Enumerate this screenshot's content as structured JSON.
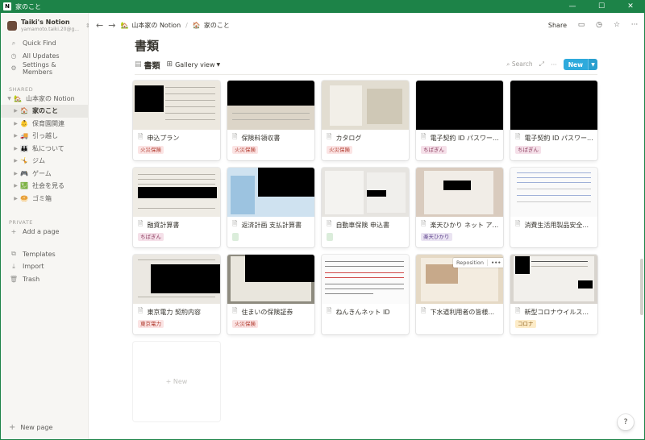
{
  "window": {
    "title": "家のこと",
    "app_icon": "N",
    "minimize": "—",
    "maximize": "☐",
    "close": "✕"
  },
  "workspace": {
    "name": "Taiki's Notion",
    "email": "yamamoto.taiki.20@g..."
  },
  "sidebar": {
    "nav": [
      {
        "label": "Quick Find",
        "icon": "search-icon"
      },
      {
        "label": "All Updates",
        "icon": "clock-icon"
      },
      {
        "label": "Settings & Members",
        "icon": "gear-icon"
      }
    ],
    "shared_label": "SHARED",
    "tree": [
      {
        "label": "山本家の Notion",
        "emoji": "🏡",
        "expanded": true,
        "level": 0
      },
      {
        "label": "家のこと",
        "emoji": "🏠",
        "active": true,
        "level": 1
      },
      {
        "label": "保育園関連",
        "emoji": "👶",
        "level": 1
      },
      {
        "label": "引っ越し",
        "emoji": "🚚",
        "level": 1
      },
      {
        "label": "私について",
        "emoji": "👪",
        "level": 1
      },
      {
        "label": "ジム",
        "emoji": "🤸",
        "level": 1
      },
      {
        "label": "ゲーム",
        "emoji": "🎮",
        "level": 1
      },
      {
        "label": "社会を見る",
        "emoji": "💹",
        "level": 1
      },
      {
        "label": "ゴミ箱",
        "emoji": "🥯",
        "level": 1
      }
    ],
    "private_label": "PRIVATE",
    "add_page": "Add a page",
    "bottom": [
      {
        "label": "Templates",
        "icon": "templates-icon"
      },
      {
        "label": "Import",
        "icon": "import-icon"
      },
      {
        "label": "Trash",
        "icon": "trash-icon"
      }
    ],
    "new_page": "New page"
  },
  "topbar": {
    "breadcrumb": [
      {
        "label": "山本家の Notion",
        "emoji": "🏡"
      },
      {
        "label": "家のこと",
        "emoji": "🏠"
      }
    ],
    "share": "Share"
  },
  "page": {
    "title": "書類",
    "db_title": "書類",
    "view": "Gallery view",
    "search": "Search",
    "new_button": "New",
    "new_card": "+ New"
  },
  "tag_colors": {
    "fire": "#fbe4e4",
    "chiba": "#f5e0e9",
    "green": "#dbeddb",
    "rakuten": "#eae4f2",
    "corona": "#fdecc8"
  },
  "cards": [
    {
      "title": "申込プラン",
      "tag": "火災保険",
      "tag_style": "fire"
    },
    {
      "title": "保険料領収書",
      "tag": "火災保険",
      "tag_style": "fire"
    },
    {
      "title": "カタログ",
      "tag": "火災保険",
      "tag_style": "fire"
    },
    {
      "title": "電子契約 ID パスワー...",
      "tag": "ちばぎん",
      "tag_style": "chiba"
    },
    {
      "title": "電子契約 ID パスワー...",
      "tag": "ちばぎん",
      "tag_style": "chiba"
    },
    {
      "title": "融資計算書",
      "tag": "ちばぎん",
      "tag_style": "chiba"
    },
    {
      "title": "返済計画 支払計算書",
      "tag": "",
      "tag_style": "green"
    },
    {
      "title": "自動車保険 申込書",
      "tag": "",
      "tag_style": "green"
    },
    {
      "title": "楽天ひかり ネット ア...",
      "tag": "楽天ひかり",
      "tag_style": "rakuten"
    },
    {
      "title": "消費生活用製品安全...",
      "tag": null,
      "tag_style": null
    },
    {
      "title": "東京電力 契約内容",
      "tag": "東京電力",
      "tag_style": "tepco"
    },
    {
      "title": "住まいの保険証券",
      "tag": "火災保険",
      "tag_style": "fire"
    },
    {
      "title": "ねんきんネット ID",
      "tag": null,
      "tag_style": null
    },
    {
      "title": "下水道利用者の皆様...",
      "tag": null,
      "tag_style": null
    },
    {
      "title": "新型コロナウイルス...",
      "tag": "コロナ",
      "tag_style": "corona"
    }
  ],
  "reposition": {
    "label": "Reposition",
    "more": "•••"
  },
  "help": "?"
}
